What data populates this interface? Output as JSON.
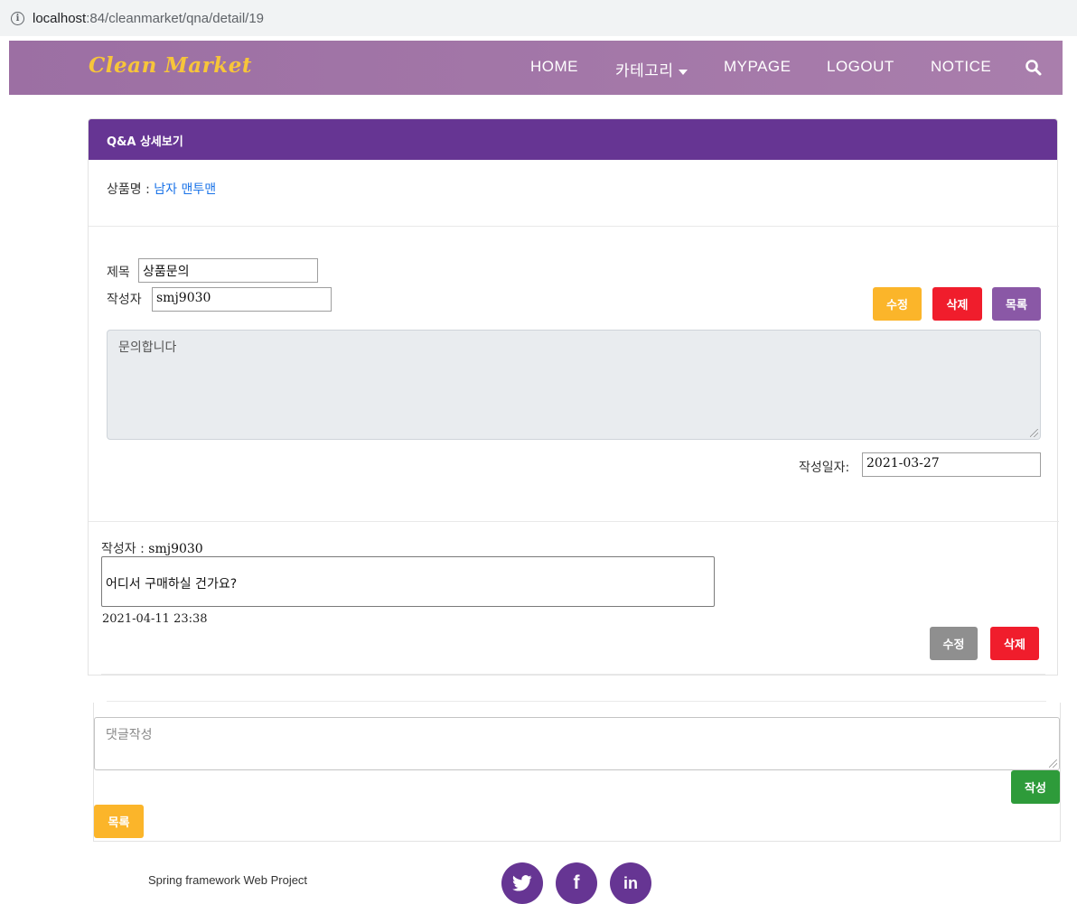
{
  "browser": {
    "url_host": "localhost",
    "url_path": ":84/cleanmarket/qna/detail/19"
  },
  "navbar": {
    "brand": "Clean Market",
    "items": [
      {
        "label": "HOME"
      },
      {
        "label": "카테고리"
      },
      {
        "label": "MYPAGE"
      },
      {
        "label": "LOGOUT"
      },
      {
        "label": "NOTICE"
      }
    ]
  },
  "card": {
    "header": "Q&A 상세보기",
    "product_label": "상품명 : ",
    "product_name": "남자 맨투맨",
    "title_label": "제목",
    "title_value": "상품문의",
    "author_label": "작성자",
    "author_value": "smj9030",
    "buttons": {
      "edit": "수정",
      "delete": "삭제",
      "list": "목록"
    },
    "content": "문의합니다",
    "date_label": "작성일자:",
    "date_value": "2021-03-27"
  },
  "reply": {
    "author_label": "작성자 : ",
    "author_value": "smj9030",
    "text": "어디서 구매하실 건가요?",
    "date": "2021-04-11 23:38",
    "edit": "수정",
    "delete": "삭제"
  },
  "comment": {
    "placeholder": "댓글작성",
    "submit": "작성",
    "list": "목록"
  },
  "footer": {
    "text": "Spring framework Web Project",
    "social_icons": [
      "twitter-icon",
      "facebook-icon",
      "linkedin-icon"
    ]
  },
  "colors": {
    "navbar": "#a07aa8",
    "header": "#663593",
    "brand": "#f7c53a",
    "warning": "#fbb52a",
    "danger": "#f01d2c",
    "purple": "#8a58a6",
    "success": "#2e9b3a"
  }
}
